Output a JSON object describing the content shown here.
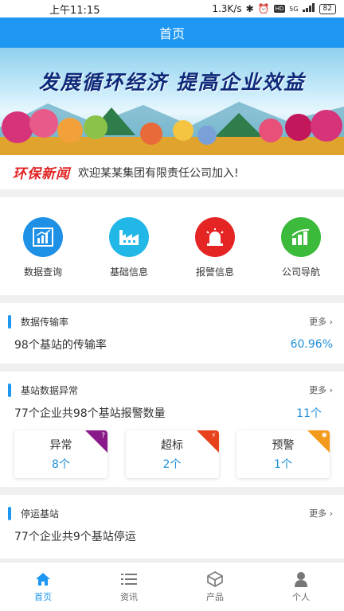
{
  "status_bar": {
    "time": "上午11:15",
    "net_speed": "1.3K/s",
    "network": "5G",
    "hd": "HD",
    "battery": "82"
  },
  "header": {
    "title": "首页"
  },
  "banner": {
    "slogan": "发展循环经济 提高企业效益"
  },
  "news": {
    "tag": "环保新闻",
    "text": "欢迎某某集团有限责任公司加入!"
  },
  "menu": [
    {
      "label": "数据查询",
      "icon": "chart-icon",
      "color": "#1e90e6"
    },
    {
      "label": "基础信息",
      "icon": "factory-icon",
      "color": "#21b7e6"
    },
    {
      "label": "报警信息",
      "icon": "alarm-icon",
      "color": "#e52424"
    },
    {
      "label": "公司导航",
      "icon": "bar-chart-icon",
      "color": "#3cba3c"
    }
  ],
  "transmission": {
    "title": "数据传输率",
    "more": "更多",
    "summary": "98个基站的传输率",
    "rate": "60.96%"
  },
  "anomaly": {
    "title": "基站数据异常",
    "more": "更多",
    "summary": "77个企业共98个基站报警数量",
    "count": "11个",
    "tiles": [
      {
        "label": "异常",
        "count": "8个",
        "corner_color": "#8a1a8a",
        "corner_icon": "?"
      },
      {
        "label": "超标",
        "count": "2个",
        "corner_color": "#e8421c",
        "corner_icon": "⚡"
      },
      {
        "label": "预警",
        "count": "1个",
        "corner_color": "#f39a1c",
        "corner_icon": "✺"
      }
    ]
  },
  "stopped": {
    "title": "停运基站",
    "more": "更多",
    "summary": "77个企业共9个基站停运"
  },
  "tabbar": [
    {
      "label": "首页",
      "icon": "home-icon",
      "active": true
    },
    {
      "label": "资讯",
      "icon": "list-icon",
      "active": false
    },
    {
      "label": "产品",
      "icon": "cube-icon",
      "active": false
    },
    {
      "label": "个人",
      "icon": "person-icon",
      "active": false
    }
  ],
  "colors": {
    "primary": "#1e97f3",
    "accent_text": "#1e8fd8",
    "news_red": "#e02424"
  }
}
